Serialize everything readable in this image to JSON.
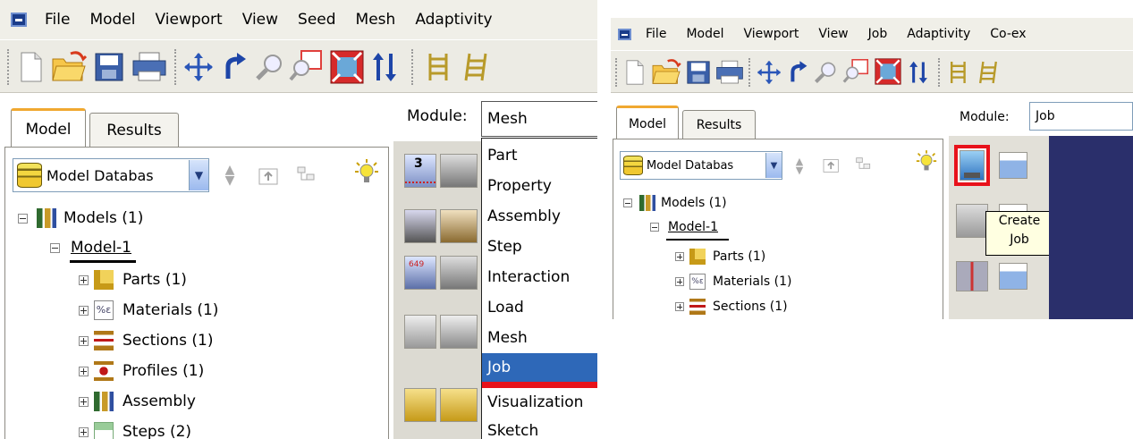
{
  "left": {
    "menu": [
      "File",
      "Model",
      "Viewport",
      "View",
      "Seed",
      "Mesh",
      "Adaptivity"
    ],
    "tabs": {
      "model": "Model",
      "results": "Results"
    },
    "module": {
      "label": "Module:",
      "value": "Mesh"
    },
    "database_combo": "Model Databas",
    "tree": {
      "models": "Models (1)",
      "model1": "Model-1",
      "parts": "Parts (1)",
      "materials": "Materials (1)",
      "sections": "Sections (1)",
      "profiles": "Profiles (1)",
      "assembly": "Assembly",
      "steps": "Steps (2)"
    },
    "module_options": [
      "Part",
      "Property",
      "Assembly",
      "Step",
      "Interaction",
      "Load",
      "Mesh",
      "Job",
      "Visualization",
      "Sketch"
    ],
    "selected_option": "Job"
  },
  "right": {
    "menu": [
      "File",
      "Model",
      "Viewport",
      "View",
      "Job",
      "Adaptivity",
      "Co-ex"
    ],
    "tabs": {
      "model": "Model",
      "results": "Results"
    },
    "module": {
      "label": "Module:",
      "value": "Job"
    },
    "database_combo": "Model Databas",
    "tree": {
      "models": "Models (1)",
      "model1": "Model-1",
      "parts": "Parts (1)",
      "materials": "Materials (1)",
      "sections": "Sections (1)"
    },
    "tooltip": {
      "line1": "Create",
      "line2": "Job"
    }
  },
  "colors": {
    "selection": "#2e68b8",
    "highlight_red": "#e8121b",
    "viewport": "#2a2f6b",
    "tooltip_bg": "#ffffe1"
  }
}
